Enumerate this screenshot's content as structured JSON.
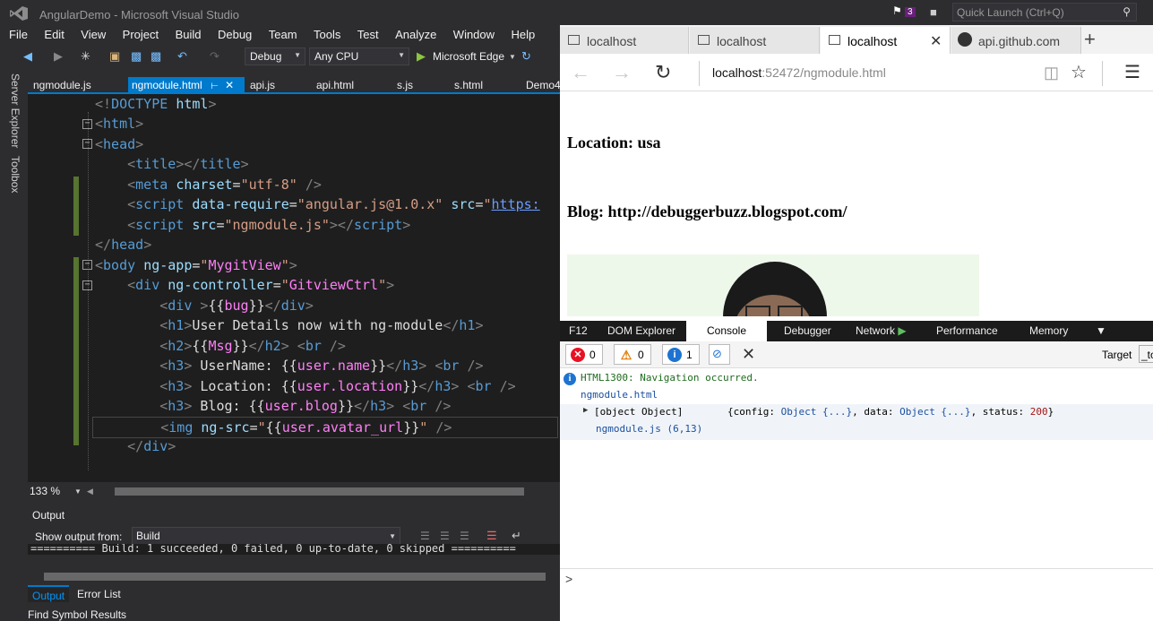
{
  "vs": {
    "title": "AngularDemo - Microsoft Visual Studio",
    "notif_count": "3",
    "quick_launch": "Quick Launch (Ctrl+Q)",
    "menu": [
      "File",
      "Edit",
      "View",
      "Project",
      "Build",
      "Debug",
      "Team",
      "Tools",
      "Test",
      "Analyze",
      "Window",
      "Help"
    ],
    "toolbar": {
      "config": "Debug",
      "platform": "Any CPU",
      "run_target": "Microsoft Edge"
    },
    "rail": [
      "Server Explorer",
      "Toolbox"
    ],
    "doc_tabs": [
      "ngmodule.js",
      "ngmodule.html",
      "api.js",
      "api.html",
      "s.js",
      "s.html",
      "Demo4"
    ],
    "zoom": "133 %",
    "output": {
      "title": "Output",
      "show_from_label": "Show output from:",
      "source": "Build",
      "text": "========== Build: 1 succeeded, 0 failed, 0 up-to-date, 0 skipped =========="
    },
    "bottom_tabs": [
      "Output",
      "Error List"
    ],
    "find_symbol": "Find Symbol Results"
  },
  "browser": {
    "tabs": [
      "localhost",
      "localhost",
      "localhost",
      "api.github.com"
    ],
    "url_host": "localhost",
    "url_rest": ":52472/ngmodule.html",
    "page": {
      "location": "Location: usa",
      "blog": "Blog: http://debuggerbuzz.blogspot.com/"
    },
    "devtools": {
      "tabs": [
        "F12",
        "DOM Explorer",
        "Console",
        "Debugger",
        "Network",
        "Performance",
        "Memory"
      ],
      "errors": "0",
      "warnings": "0",
      "infos": "1",
      "target_label": "Target",
      "target_value": "_to",
      "console": {
        "msg": "HTML1300: Navigation occurred.",
        "msg_src": "ngmodule.html",
        "obj": "[object Object]",
        "obj_detail_pre": "{config: ",
        "obj_a": "Object {...}",
        "obj_mid": ", data: ",
        "obj_b": "Object {...}",
        "obj_end": ", status: ",
        "status": "200",
        "obj_close": "}",
        "obj_src": "ngmodule.js (6,13)",
        "prompt": ">"
      }
    }
  }
}
